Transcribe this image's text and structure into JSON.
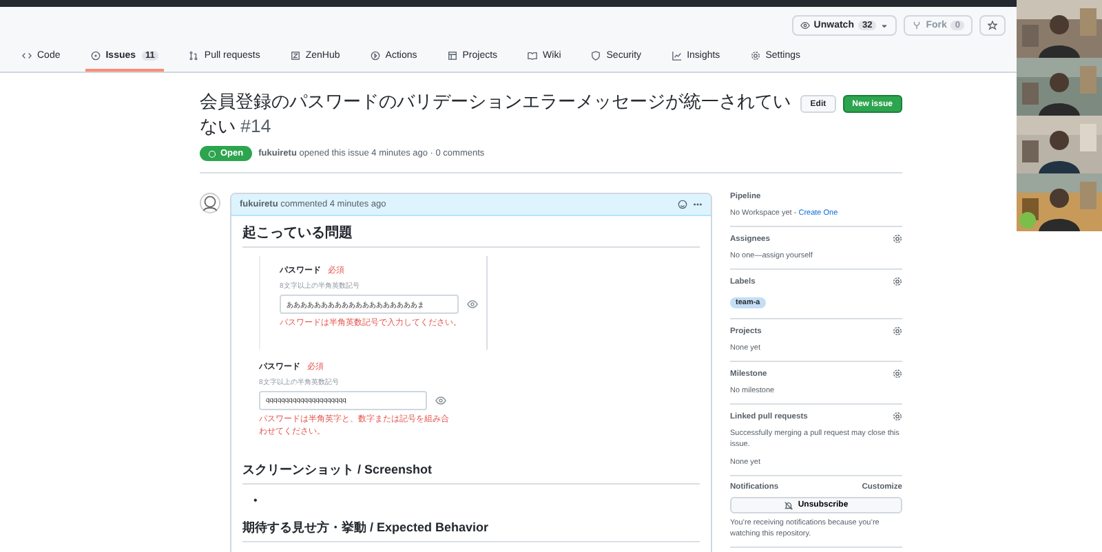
{
  "repo_actions": [
    {
      "kind": "watch",
      "label": "Unwatch",
      "count": "32"
    },
    {
      "kind": "fork",
      "label": "Fork",
      "count": "0"
    },
    {
      "kind": "star"
    }
  ],
  "tabs": [
    {
      "label": "Code",
      "selected": false
    },
    {
      "label": "Issues",
      "count": "11",
      "selected": true
    },
    {
      "label": "Pull requests",
      "selected": false
    },
    {
      "label": "ZenHub",
      "selected": false
    },
    {
      "label": "Actions",
      "selected": false
    },
    {
      "label": "Projects",
      "selected": false
    },
    {
      "label": "Wiki",
      "selected": false
    },
    {
      "label": "Security",
      "selected": false
    },
    {
      "label": "Insights",
      "selected": false
    },
    {
      "label": "Settings",
      "selected": false
    }
  ],
  "issue": {
    "title": "会員登録のパスワードのバリデーションエラーメッセージが統一されていない",
    "number": "#14",
    "edit_button": "Edit",
    "new_button": "New issue",
    "state": "Open",
    "author": "fukuiretu",
    "meta": "opened this issue 4 minutes ago · 0 comments"
  },
  "comment": {
    "author": "fukuiretu",
    "time": "commented 4 minutes ago",
    "heading": "起こっている問題",
    "examples": [
      {
        "bordered": true,
        "label": "パスワード",
        "required": "必須",
        "hint": "8文字以上の半角英数記号",
        "value": "あああああああああああああああああああま",
        "error": "パスワードは半角英数記号で入力してください。"
      },
      {
        "bordered": false,
        "label": "パスワード",
        "required": "必須",
        "hint": "8文字以上の半角英数記号",
        "value": "qqqqqqqqqqqqqqqqqqqqq",
        "error": "パスワードは半角英字と、数字または記号を組み合わせてください。"
      }
    ],
    "sections": [
      {
        "heading": "スクリーンショット / Screenshot",
        "bullet": "•"
      },
      {
        "heading": "期待する見せ方・挙動 / Expected Behavior"
      }
    ]
  },
  "sidebar": [
    {
      "title": "Pipeline",
      "gear": false,
      "lines": [
        {
          "text": "No Workspace yet - "
        }
      ],
      "link": "Create One"
    },
    {
      "title": "Assignees",
      "gear": true,
      "lines": [
        {
          "text": "No one—assign yourself"
        }
      ]
    },
    {
      "title": "Labels",
      "gear": true,
      "labels": [
        "team-a"
      ]
    },
    {
      "title": "Projects",
      "gear": true,
      "lines": [
        {
          "text": "None yet"
        }
      ]
    },
    {
      "title": "Milestone",
      "gear": true,
      "lines": [
        {
          "text": "No milestone"
        }
      ]
    },
    {
      "title": "Linked pull requests",
      "gear": true,
      "lines": [
        {
          "text": "Successfully merging a pull request may close this issue."
        },
        {
          "text": "None yet"
        }
      ]
    }
  ],
  "notifications": {
    "title": "Notifications",
    "customize": "Customize",
    "button": "Unsubscribe",
    "note": "You’re receiving notifications because you’re watching this repository."
  }
}
